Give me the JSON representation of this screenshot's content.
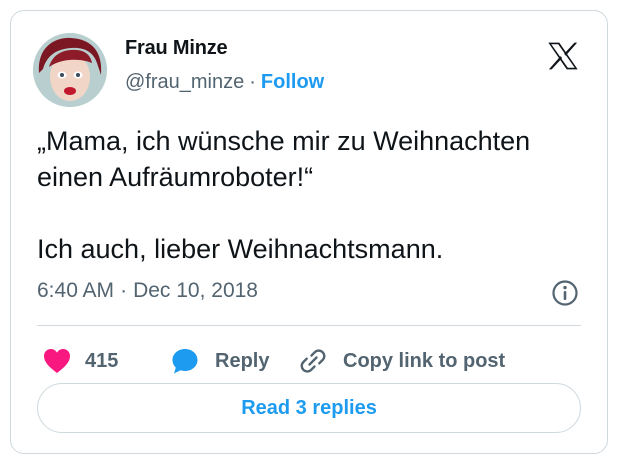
{
  "author": {
    "name": "Frau Minze",
    "handle": "@frau_minze",
    "separator": "·",
    "follow_label": "Follow"
  },
  "tweet": {
    "line1": "„Mama, ich wünsche mir zu Weihnachten",
    "line2": "einen Aufräumroboter!“",
    "line3": "Ich auch, lieber Weihnachtsmann.",
    "time": "6:40 AM",
    "date": "Dec 10, 2018"
  },
  "actions": {
    "like_count": "415",
    "reply_label": "Reply",
    "copy_label": "Copy link to post"
  },
  "footer": {
    "read_replies_label": "Read 3 replies"
  },
  "icons": {
    "logo": "x-logo-icon",
    "info": "info-icon",
    "heart": "heart-icon",
    "reply": "speech-bubble-icon",
    "link": "link-icon"
  },
  "colors": {
    "accent": "#1d9bf0",
    "like": "#f91880",
    "text": "#0f1419",
    "muted": "#536471",
    "border": "#cfd9de"
  }
}
